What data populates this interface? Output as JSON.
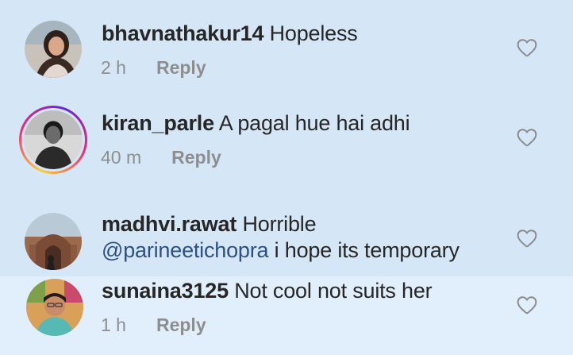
{
  "comments": [
    {
      "username": "bhavnathakur14",
      "text": "Hopeless",
      "time": "2 h",
      "reply": "Reply"
    },
    {
      "username": "kiran_parle",
      "text": "A pagal hue hai adhi",
      "time": "40 m",
      "reply": "Reply"
    },
    {
      "username": "madhvi.rawat",
      "text": "Horrible",
      "mention": "@parineetichopra",
      "text2": "i hope its temporary"
    },
    {
      "username": "sunaina3125",
      "text": "Not cool not suits her",
      "time": "1 h",
      "reply": "Reply"
    }
  ],
  "icons": {
    "like": "heart-outline-icon",
    "avatar": "user-avatar"
  },
  "colors": {
    "background": "#d5e7f7",
    "username": "#262626",
    "meta": "#8e8e8e",
    "mention": "#2b4f86"
  }
}
